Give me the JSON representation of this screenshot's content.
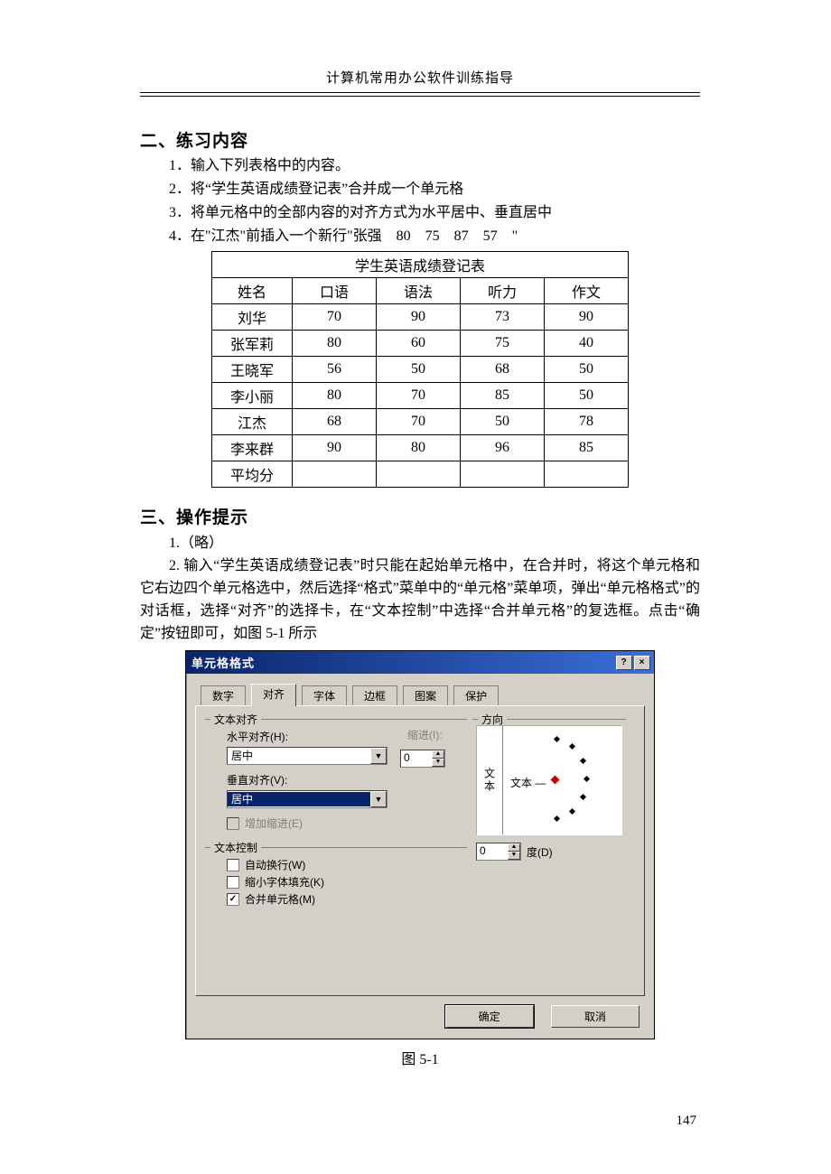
{
  "runningHead": "计算机常用办公软件训练指导",
  "sectionA": {
    "title": "二、练习内容",
    "items": [
      "1．输入下列表格中的内容。",
      "2．将“学生英语成绩登记表”合并成一个单元格",
      "3．将单元格中的全部内容的对齐方式为水平居中、垂直居中",
      "4．在\"江杰\"前插入一个新行\"张强　80　75　87　57　\""
    ]
  },
  "table": {
    "caption": "学生英语成绩登记表",
    "headers": [
      "姓名",
      "口语",
      "语法",
      "听力",
      "作文"
    ],
    "rows": [
      [
        "刘华",
        "70",
        "90",
        "73",
        "90"
      ],
      [
        "张军莉",
        "80",
        "60",
        "75",
        "40"
      ],
      [
        "王晓军",
        "56",
        "50",
        "68",
        "50"
      ],
      [
        "李小丽",
        "80",
        "70",
        "85",
        "50"
      ],
      [
        "江杰",
        "68",
        "70",
        "50",
        "78"
      ],
      [
        "李来群",
        "90",
        "80",
        "96",
        "85"
      ],
      [
        "平均分",
        "",
        "",
        "",
        ""
      ]
    ]
  },
  "sectionB": {
    "title": "三、操作提示",
    "p1": "1.（略）",
    "p2": "2. 输入“学生英语成绩登记表”时只能在起始单元格中，在合并时，将这个单元格和它右边四个单元格选中，然后选择“格式”菜单中的“单元格”菜单项，弹出“单元格格式”的对话框，选择“对齐”的选择卡，在“文本控制”中选择“合并单元格”的复选框。点击“确定”按钮即可，如图 5-1 所示"
  },
  "dialog": {
    "title": "单元格格式",
    "helpGlyph": "?",
    "closeGlyph": "×",
    "tabs": [
      "数字",
      "对齐",
      "字体",
      "边框",
      "图案",
      "保护"
    ],
    "activeTab": 1,
    "groups": {
      "textAlign": "文本对齐",
      "hAlignLabel": "水平对齐(H):",
      "hAlignValue": "居中",
      "indentLabel": "缩进(I):",
      "indentValue": "0",
      "vAlignLabel": "垂直对齐(V):",
      "vAlignValue": "居中",
      "addIndent": "增加缩进(E)",
      "textControl": "文本控制",
      "wrap": "自动换行(W)",
      "shrink": "缩小字体填充(K)",
      "merge": "合并单元格(M)",
      "direction": "方向",
      "verticalText": "文本",
      "angleText": "文本 —",
      "degValue": "0",
      "degLabel": "度(D)"
    },
    "buttons": {
      "ok": "确定",
      "cancel": "取消"
    }
  },
  "figureCaption": "图 5-1",
  "pageNum": "147"
}
